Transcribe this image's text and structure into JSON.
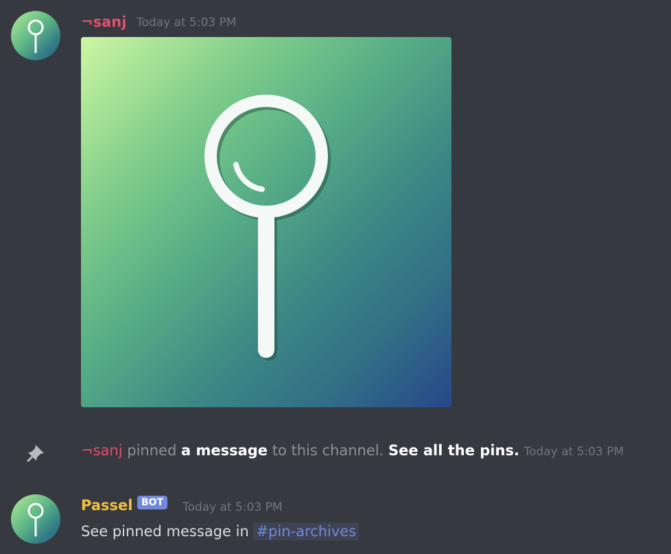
{
  "messages": [
    {
      "author": "¬sanj",
      "author_color": "#e0526e",
      "timestamp": "Today at 5:03 PM",
      "attachment": "image-magnifier-pin-logo"
    },
    {
      "system": true,
      "icon": "pin-icon",
      "author": "¬sanj",
      "text_1": "pinned",
      "link_1": "a message",
      "text_2": "to this channel.",
      "link_2": "See all the pins.",
      "timestamp": "Today at 5:03 PM"
    },
    {
      "author": "Passel",
      "author_color": "#f0c040",
      "badge": "BOT",
      "badge_color": "#7289da",
      "timestamp": "Today at 5:03 PM",
      "text": "See pinned message in",
      "channel_mention": "#pin-archives"
    }
  ]
}
